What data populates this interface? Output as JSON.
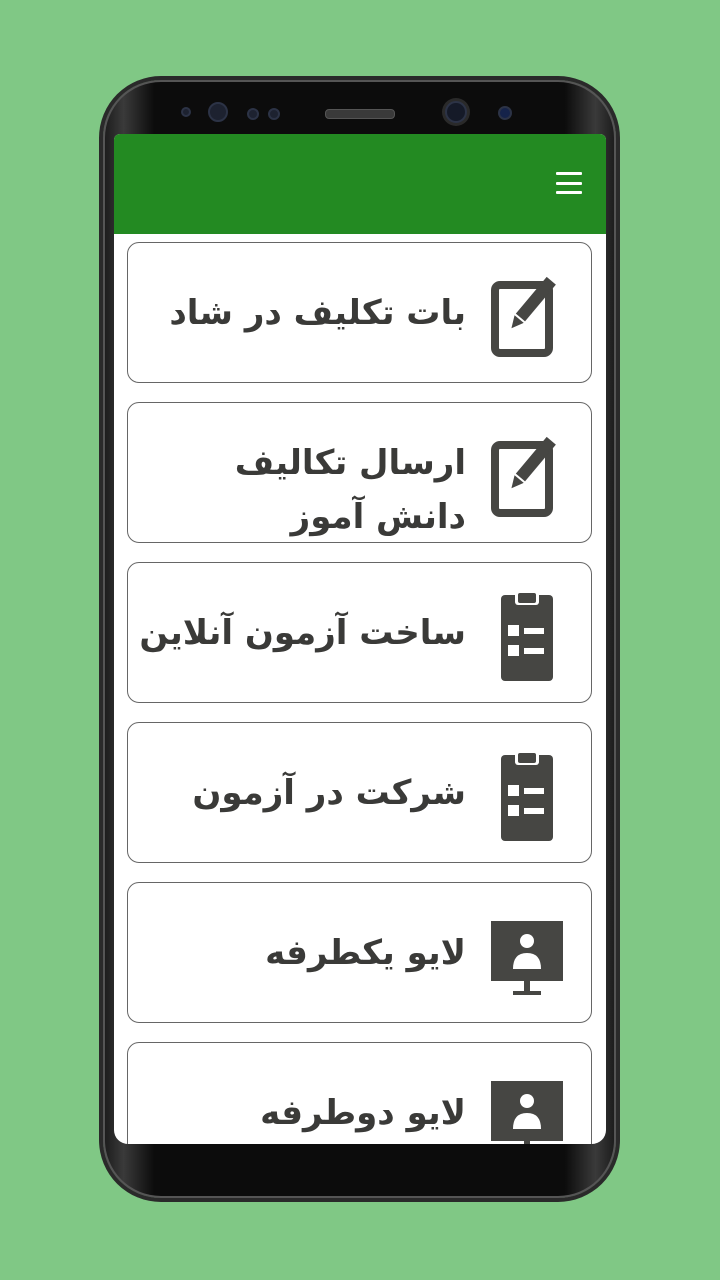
{
  "colors": {
    "page_background": "#80c885",
    "appbar": "#238a22",
    "card_text": "#3a3a38",
    "icon": "#464643"
  },
  "appbar": {
    "menu_icon": "hamburger-menu-icon"
  },
  "menu_items": [
    {
      "label": "بات تکلیف در شاد",
      "icon": "edit-icon"
    },
    {
      "label": "ارسال تکالیف دانش آموز",
      "icon": "edit-icon"
    },
    {
      "label": "ساخت آزمون آنلاین",
      "icon": "clipboard-list-icon"
    },
    {
      "label": "شرکت در آزمون",
      "icon": "clipboard-list-icon"
    },
    {
      "label": "لایو یکطرفه",
      "icon": "presenter-screen-icon"
    },
    {
      "label": "لایو دوطرفه",
      "icon": "presenter-screen-icon"
    }
  ]
}
